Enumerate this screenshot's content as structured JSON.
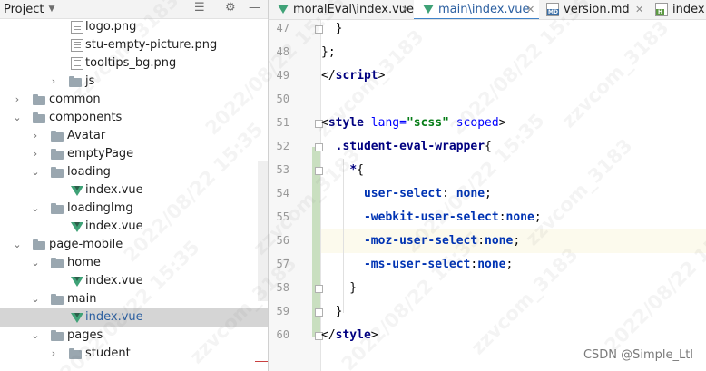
{
  "project_panel": {
    "title": "Project",
    "tree": [
      {
        "label": "logo.png",
        "type": "png",
        "level": 4
      },
      {
        "label": "stu-empty-picture.png",
        "type": "png",
        "level": 4
      },
      {
        "label": "tooltips_bg.png",
        "type": "png",
        "level": 4
      },
      {
        "label": "js",
        "type": "folder",
        "level": 3,
        "expanded": false
      },
      {
        "label": "common",
        "type": "folder",
        "level": 1,
        "expanded": false
      },
      {
        "label": "components",
        "type": "folder",
        "level": 1,
        "expanded": true
      },
      {
        "label": "Avatar",
        "type": "folder",
        "level": 2,
        "expanded": false
      },
      {
        "label": "emptyPage",
        "type": "folder",
        "level": 2,
        "expanded": false
      },
      {
        "label": "loading",
        "type": "folder",
        "level": 2,
        "expanded": true
      },
      {
        "label": "index.vue",
        "type": "vue",
        "level": 3
      },
      {
        "label": "loadingImg",
        "type": "folder",
        "level": 2,
        "expanded": true
      },
      {
        "label": "index.vue",
        "type": "vue",
        "level": 3
      },
      {
        "label": "page-mobile",
        "type": "folder",
        "level": 1,
        "expanded": true
      },
      {
        "label": "home",
        "type": "folder",
        "level": 2,
        "expanded": true
      },
      {
        "label": "index.vue",
        "type": "vue",
        "level": 3
      },
      {
        "label": "main",
        "type": "folder",
        "level": 2,
        "expanded": true
      },
      {
        "label": "index.vue",
        "type": "vue",
        "level": 3,
        "selected": true
      },
      {
        "label": "pages",
        "type": "folder",
        "level": 2,
        "expanded": true
      },
      {
        "label": "student",
        "type": "folder",
        "level": 3,
        "expanded": false
      }
    ]
  },
  "tabs": [
    {
      "label": "moralEval\\index.vue",
      "icon": "vue-icon",
      "active": false
    },
    {
      "label": "main\\index.vue",
      "icon": "vue-icon",
      "active": true
    },
    {
      "label": "version.md",
      "icon": "markdown-file-icon",
      "badge": "MD",
      "active": false
    },
    {
      "label": "index.ht",
      "icon": "html-file-icon",
      "badge": "H",
      "active": false
    }
  ],
  "editor": {
    "current_line": 56,
    "lines": [
      {
        "num": 47,
        "tokens": [
          {
            "t": "  }",
            "c": ""
          }
        ]
      },
      {
        "num": 48,
        "tokens": [
          {
            "t": "};",
            "c": ""
          }
        ]
      },
      {
        "num": 49,
        "tokens": [
          {
            "t": "</",
            "c": ""
          },
          {
            "t": "script",
            "c": "kw"
          },
          {
            "t": ">",
            "c": ""
          }
        ]
      },
      {
        "num": 50,
        "tokens": []
      },
      {
        "num": 51,
        "tokens": [
          {
            "t": "<",
            "c": ""
          },
          {
            "t": "style ",
            "c": "kw"
          },
          {
            "t": "lang=",
            "c": "attr"
          },
          {
            "t": "\"scss\"",
            "c": "str"
          },
          {
            "t": " scoped",
            "c": "attr"
          },
          {
            "t": ">",
            "c": ""
          }
        ]
      },
      {
        "num": 52,
        "tokens": [
          {
            "t": "  ",
            "c": ""
          },
          {
            "t": ".student-eval-wrapper",
            "c": "sel"
          },
          {
            "t": "{",
            "c": ""
          }
        ]
      },
      {
        "num": 53,
        "tokens": [
          {
            "t": "    ",
            "c": ""
          },
          {
            "t": "*",
            "c": "sel"
          },
          {
            "t": "{",
            "c": ""
          }
        ]
      },
      {
        "num": 54,
        "tokens": [
          {
            "t": "      ",
            "c": ""
          },
          {
            "t": "user-select",
            "c": "prop"
          },
          {
            "t": ": ",
            "c": ""
          },
          {
            "t": "none",
            "c": "val"
          },
          {
            "t": ";",
            "c": ""
          }
        ]
      },
      {
        "num": 55,
        "tokens": [
          {
            "t": "      ",
            "c": ""
          },
          {
            "t": "-webkit-user-select",
            "c": "prop"
          },
          {
            "t": ":",
            "c": ""
          },
          {
            "t": "none",
            "c": "val"
          },
          {
            "t": ";",
            "c": ""
          }
        ]
      },
      {
        "num": 56,
        "tokens": [
          {
            "t": "      ",
            "c": ""
          },
          {
            "t": "-moz-user-select",
            "c": "prop"
          },
          {
            "t": ":",
            "c": ""
          },
          {
            "t": "none",
            "c": "val"
          },
          {
            "t": ";",
            "c": ""
          }
        ]
      },
      {
        "num": 57,
        "tokens": [
          {
            "t": "      ",
            "c": ""
          },
          {
            "t": "-ms-user-select",
            "c": "prop"
          },
          {
            "t": ":",
            "c": ""
          },
          {
            "t": "none",
            "c": "val"
          },
          {
            "t": ";",
            "c": ""
          }
        ]
      },
      {
        "num": 58,
        "tokens": [
          {
            "t": "    }",
            "c": ""
          }
        ]
      },
      {
        "num": 59,
        "tokens": [
          {
            "t": "  }",
            "c": ""
          }
        ]
      },
      {
        "num": 60,
        "tokens": [
          {
            "t": "</",
            "c": ""
          },
          {
            "t": "style",
            "c": "kw"
          },
          {
            "t": ">",
            "c": ""
          }
        ]
      }
    ]
  },
  "watermark": {
    "texts": [
      "zzvcom_3183",
      "2022/08/22 15:35"
    ]
  },
  "credit": "CSDN @Simple_Ltl",
  "colors": {
    "accent": "#4083c9",
    "vue_green": "#3fa277",
    "selection": "#d5d5d5",
    "current_line": "#fcfaed"
  }
}
